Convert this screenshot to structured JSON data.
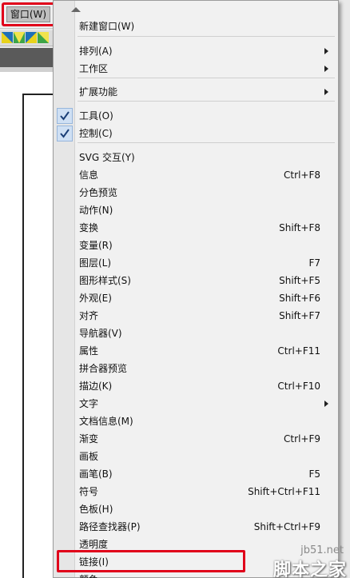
{
  "menubar": {
    "window_menu_label": "窗口(W)"
  },
  "menu": {
    "items": [
      {
        "label": "新建窗口(W)",
        "shortcut": "",
        "submenu": false,
        "checked": false
      },
      {
        "label": "排列(A)",
        "shortcut": "",
        "submenu": true,
        "checked": false
      },
      {
        "label": "工作区",
        "shortcut": "",
        "submenu": true,
        "checked": false
      },
      {
        "label": "扩展功能",
        "shortcut": "",
        "submenu": true,
        "checked": false
      },
      {
        "label": "工具(O)",
        "shortcut": "",
        "submenu": false,
        "checked": true
      },
      {
        "label": "控制(C)",
        "shortcut": "",
        "submenu": false,
        "checked": true
      },
      {
        "label": "SVG 交互(Y)",
        "shortcut": "",
        "submenu": false,
        "checked": false
      },
      {
        "label": "信息",
        "shortcut": "Ctrl+F8",
        "submenu": false,
        "checked": false
      },
      {
        "label": "分色预览",
        "shortcut": "",
        "submenu": false,
        "checked": false
      },
      {
        "label": "动作(N)",
        "shortcut": "",
        "submenu": false,
        "checked": false
      },
      {
        "label": "变换",
        "shortcut": "Shift+F8",
        "submenu": false,
        "checked": false
      },
      {
        "label": "变量(R)",
        "shortcut": "",
        "submenu": false,
        "checked": false
      },
      {
        "label": "图层(L)",
        "shortcut": "F7",
        "submenu": false,
        "checked": false
      },
      {
        "label": "图形样式(S)",
        "shortcut": "Shift+F5",
        "submenu": false,
        "checked": false
      },
      {
        "label": "外观(E)",
        "shortcut": "Shift+F6",
        "submenu": false,
        "checked": false
      },
      {
        "label": "对齐",
        "shortcut": "Shift+F7",
        "submenu": false,
        "checked": false
      },
      {
        "label": "导航器(V)",
        "shortcut": "",
        "submenu": false,
        "checked": false
      },
      {
        "label": "属性",
        "shortcut": "Ctrl+F11",
        "submenu": false,
        "checked": false
      },
      {
        "label": "拼合器预览",
        "shortcut": "",
        "submenu": false,
        "checked": false
      },
      {
        "label": "描边(K)",
        "shortcut": "Ctrl+F10",
        "submenu": false,
        "checked": false
      },
      {
        "label": "文字",
        "shortcut": "",
        "submenu": true,
        "checked": false
      },
      {
        "label": "文档信息(M)",
        "shortcut": "",
        "submenu": false,
        "checked": false
      },
      {
        "label": "渐变",
        "shortcut": "Ctrl+F9",
        "submenu": false,
        "checked": false
      },
      {
        "label": "画板",
        "shortcut": "",
        "submenu": false,
        "checked": false
      },
      {
        "label": "画笔(B)",
        "shortcut": "F5",
        "submenu": false,
        "checked": false
      },
      {
        "label": "符号",
        "shortcut": "Shift+Ctrl+F11",
        "submenu": false,
        "checked": false
      },
      {
        "label": "色板(H)",
        "shortcut": "",
        "submenu": false,
        "checked": false
      },
      {
        "label": "路径查找器(P)",
        "shortcut": "Shift+Ctrl+F9",
        "submenu": false,
        "checked": false
      },
      {
        "label": "透明度",
        "shortcut": "",
        "submenu": false,
        "checked": false
      },
      {
        "label": "链接(I)",
        "shortcut": "",
        "submenu": false,
        "checked": false
      },
      {
        "label": "颜色",
        "shortcut": "",
        "submenu": false,
        "checked": false
      }
    ]
  },
  "watermark": {
    "url": "jb51.net",
    "name": "脚本之家"
  },
  "colors": {
    "highlight_red": "#e0001a",
    "check_bg": "#cfe0f4"
  }
}
